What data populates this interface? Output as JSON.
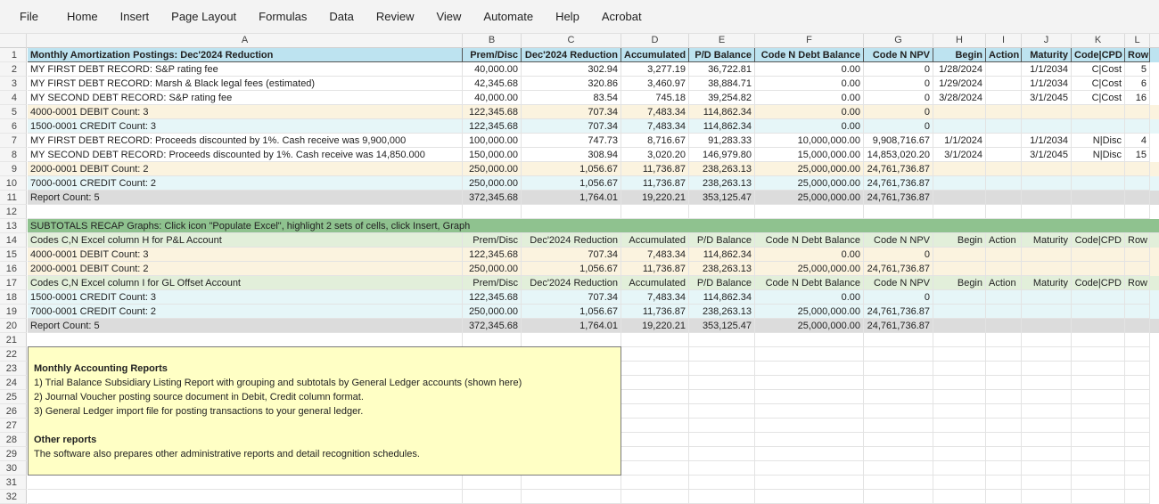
{
  "menu": [
    "File",
    "Home",
    "Insert",
    "Page Layout",
    "Formulas",
    "Data",
    "Review",
    "View",
    "Automate",
    "Help",
    "Acrobat"
  ],
  "columns": [
    "A",
    "B",
    "C",
    "D",
    "E",
    "F",
    "G",
    "H",
    "I",
    "J",
    "K",
    "L"
  ],
  "row_numbers": [
    "1",
    "2",
    "3",
    "4",
    "5",
    "6",
    "7",
    "8",
    "9",
    "10",
    "11",
    "12",
    "13",
    "14",
    "15",
    "16",
    "17",
    "18",
    "19",
    "20",
    "21",
    "22",
    "23",
    "24",
    "25",
    "26",
    "27",
    "28",
    "29",
    "30",
    "31",
    "32"
  ],
  "table": {
    "header": [
      "Monthly Amortization Postings: Dec'2024 Reduction",
      "Prem/Disc",
      "Dec'2024 Reduction",
      "Accumulated",
      "P/D Balance",
      "Code N Debt Balance",
      "Code N NPV",
      "Begin",
      "Action",
      "Maturity",
      "Code|CPD",
      "Row"
    ],
    "rows": [
      [
        "MY FIRST DEBT RECORD: S&P rating fee",
        "40,000.00",
        "302.94",
        "3,277.19",
        "36,722.81",
        "0.00",
        "0",
        "1/28/2024",
        "",
        "1/1/2034",
        "C|Cost",
        "5"
      ],
      [
        "MY FIRST DEBT RECORD: Marsh & Black legal fees (estimated)",
        "42,345.68",
        "320.86",
        "3,460.97",
        "38,884.71",
        "0.00",
        "0",
        "1/29/2024",
        "",
        "1/1/2034",
        "C|Cost",
        "6"
      ],
      [
        "MY SECOND DEBT RECORD: S&P rating fee",
        "40,000.00",
        "83.54",
        "745.18",
        "39,254.82",
        "0.00",
        "0",
        "3/28/2024",
        "",
        "3/1/2045",
        "C|Cost",
        "16"
      ],
      [
        "4000-0001  DEBIT Count: 3",
        "122,345.68",
        "707.34",
        "7,483.34",
        "114,862.34",
        "0.00",
        "0",
        "",
        "",
        "",
        "",
        ""
      ],
      [
        "1500-0001  CREDIT Count: 3",
        "122,345.68",
        "707.34",
        "7,483.34",
        "114,862.34",
        "0.00",
        "0",
        "",
        "",
        "",
        "",
        ""
      ],
      [
        "MY FIRST DEBT RECORD: Proceeds discounted by 1%. Cash receive was 9,900,000",
        "100,000.00",
        "747.73",
        "8,716.67",
        "91,283.33",
        "10,000,000.00",
        "9,908,716.67",
        "1/1/2024",
        "",
        "1/1/2034",
        "N|Disc",
        "4"
      ],
      [
        "MY SECOND DEBT RECORD: Proceeds discounted by 1%. Cash receive was 14,850.000",
        "150,000.00",
        "308.94",
        "3,020.20",
        "146,979.80",
        "15,000,000.00",
        "14,853,020.20",
        "3/1/2024",
        "",
        "3/1/2045",
        "N|Disc",
        "15"
      ],
      [
        "2000-0001  DEBIT Count: 2",
        "250,000.00",
        "1,056.67",
        "11,736.87",
        "238,263.13",
        "25,000,000.00",
        "24,761,736.87",
        "",
        "",
        "",
        "",
        ""
      ],
      [
        "7000-0001  CREDIT Count: 2",
        "250,000.00",
        "1,056.67",
        "11,736.87",
        "238,263.13",
        "25,000,000.00",
        "24,761,736.87",
        "",
        "",
        "",
        "",
        ""
      ],
      [
        "Report Count: 5",
        "372,345.68",
        "1,764.01",
        "19,220.21",
        "353,125.47",
        "25,000,000.00",
        "24,761,736.87",
        "",
        "",
        "",
        "",
        ""
      ]
    ]
  },
  "recap": {
    "title": "SUBTOTALS RECAP  Graphs: Click icon \"Populate Excel\", highlight 2 sets of cells, click Insert, Graph",
    "rows": [
      [
        "Codes C,N Excel column H for P&L Account",
        "Prem/Disc",
        "Dec'2024 Reduction",
        "Accumulated",
        "P/D Balance",
        "Code N Debt Balance",
        "Code N NPV",
        "Begin",
        "Action",
        "Maturity",
        "Code|CPD",
        "Row"
      ],
      [
        "4000-0001  DEBIT Count: 3",
        "122,345.68",
        "707.34",
        "7,483.34",
        "114,862.34",
        "0.00",
        "0",
        "",
        "",
        "",
        "",
        ""
      ],
      [
        "2000-0001  DEBIT Count: 2",
        "250,000.00",
        "1,056.67",
        "11,736.87",
        "238,263.13",
        "25,000,000.00",
        "24,761,736.87",
        "",
        "",
        "",
        "",
        ""
      ],
      [
        "Codes C,N Excel column I for GL Offset Account",
        "Prem/Disc",
        "Dec'2024 Reduction",
        "Accumulated",
        "P/D Balance",
        "Code N Debt Balance",
        "Code N NPV",
        "Begin",
        "Action",
        "Maturity",
        "Code|CPD",
        "Row"
      ],
      [
        "1500-0001  CREDIT Count: 3",
        "122,345.68",
        "707.34",
        "7,483.34",
        "114,862.34",
        "0.00",
        "0",
        "",
        "",
        "",
        "",
        ""
      ],
      [
        "7000-0001  CREDIT Count: 2",
        "250,000.00",
        "1,056.67",
        "11,736.87",
        "238,263.13",
        "25,000,000.00",
        "24,761,736.87",
        "",
        "",
        "",
        "",
        ""
      ],
      [
        "Report Count: 5",
        "372,345.68",
        "1,764.01",
        "19,220.21",
        "353,125.47",
        "25,000,000.00",
        "24,761,736.87",
        "",
        "",
        "",
        "",
        ""
      ]
    ]
  },
  "note": {
    "heading1": "Monthly Accounting Reports",
    "item1": "1) Trial Balance Subsidiary Listing Report with grouping and subtotals by General Ledger accounts (shown here)",
    "item2": "2) Journal Voucher posting source document in Debit, Credit column format.",
    "item3": "3) General Ledger import file for posting transactions to your general ledger.",
    "heading2": "Other reports",
    "item4": "The software also prepares other administrative reports and detail recognition schedules."
  },
  "colors": {
    "header_blue": "#bde3f0",
    "debit_beige": "#fbf3df",
    "credit_aqua": "#e6f6f8",
    "report_gray": "#dcdcdc",
    "recap_green": "#8fc28f",
    "recap_subhdr": "#e2efda",
    "note_yellow": "#ffffc5"
  }
}
